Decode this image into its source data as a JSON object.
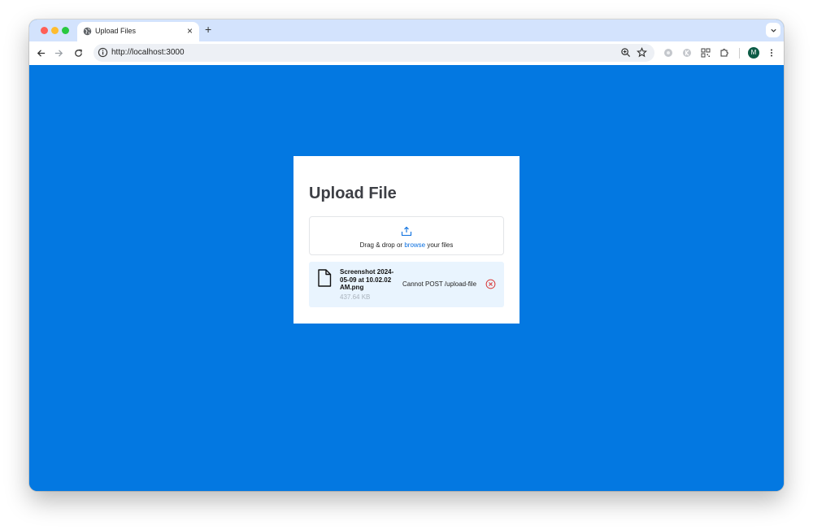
{
  "browser": {
    "tab_title": "Upload Files",
    "tab_close": "×",
    "new_tab": "+",
    "url": "http://localhost:3000",
    "profile_initial": "M"
  },
  "upload": {
    "title": "Upload File",
    "drop_prefix": "Drag & drop or ",
    "browse_link": "browse",
    "drop_suffix": " your files",
    "file": {
      "name": "Screenshot 2024-05-09 at 10.02.02 AM.png",
      "size": "437.64 KB",
      "error": "Cannot POST /upload-file"
    }
  },
  "colors": {
    "background": "#0378e1",
    "browse_link": "#0a6fe0",
    "file_row": "#e9f4fe",
    "error_icon": "#d93a3a"
  }
}
